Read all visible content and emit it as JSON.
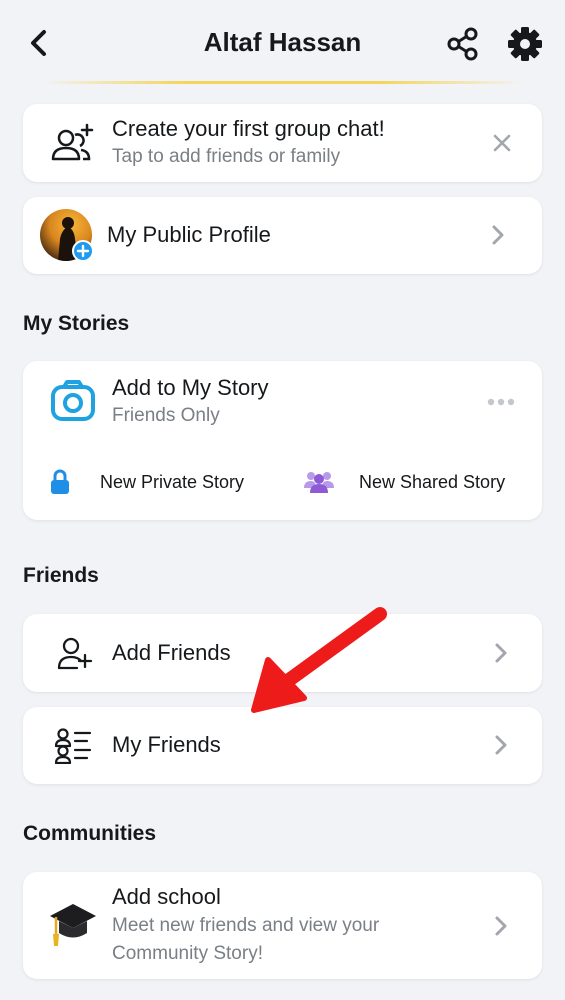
{
  "header": {
    "title": "Altaf Hassan",
    "back_icon": "chevron-left-icon",
    "share_icon": "share-icon",
    "settings_icon": "gear-icon"
  },
  "group_chat_card": {
    "title": "Create your first group chat!",
    "subtitle": "Tap to add friends or family",
    "icon": "add-group-icon",
    "dismiss_icon": "close-icon"
  },
  "public_profile": {
    "label": "My Public Profile",
    "avatar": "profile-avatar",
    "badge_icon": "plus-icon"
  },
  "my_stories": {
    "heading": "My Stories",
    "add_story": {
      "title": "Add to My Story",
      "subtitle": "Friends Only",
      "icon": "camera-icon",
      "more_icon": "more-dots-icon"
    },
    "private_story": {
      "label": "New Private Story",
      "icon": "lock-icon"
    },
    "shared_story": {
      "label": "New Shared Story",
      "icon": "group-icon"
    }
  },
  "friends": {
    "heading": "Friends",
    "add_friends": {
      "label": "Add Friends",
      "icon": "add-friend-icon"
    },
    "my_friends": {
      "label": "My Friends",
      "icon": "friends-list-icon"
    }
  },
  "communities": {
    "heading": "Communities",
    "add_school": {
      "title": "Add school",
      "subtitle_line1": "Meet new friends and view your",
      "subtitle_line2": "Community Story!",
      "icon": "graduation-cap-icon"
    }
  },
  "colors": {
    "background": "#f2f3f6",
    "card": "#ffffff",
    "camera_blue": "#1ea2e0",
    "lock_blue": "#1e8fe6",
    "group_purple": "#8e5ad6",
    "annotation_red": "#ee1b1b",
    "secondary_text": "#7a7f85"
  }
}
